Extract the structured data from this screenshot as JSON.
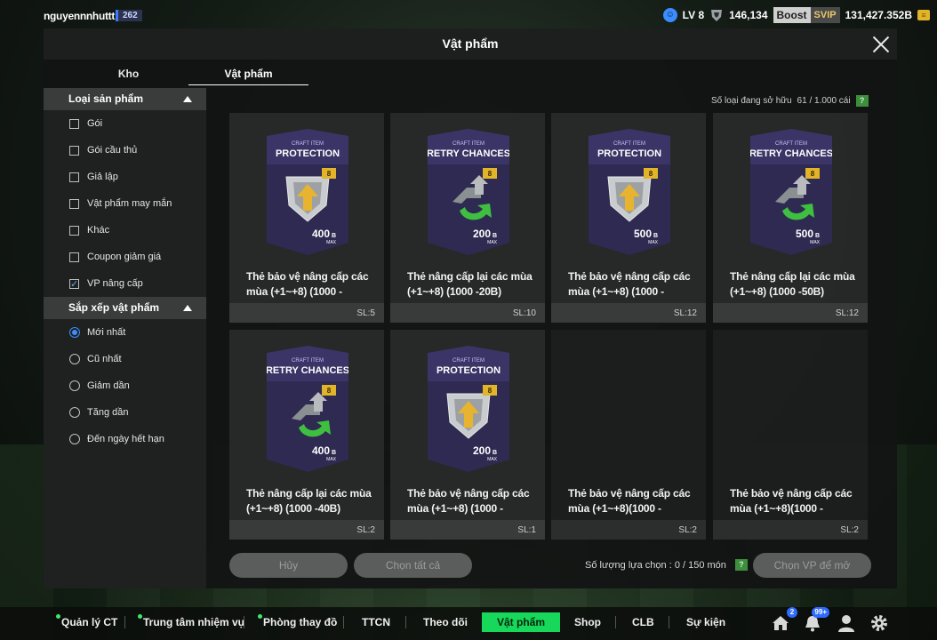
{
  "top": {
    "username": "nguyennnhuttt",
    "user_level": "262",
    "lv": "LV 8",
    "points": "146,134",
    "boost": "Boost",
    "svip": "SVIP",
    "balance": "131,427.352B"
  },
  "modal": {
    "title": "Vật phẩm",
    "tabs": [
      "Kho",
      "Vật phẩm"
    ]
  },
  "sidebar": {
    "product_type_title": "Loại sản phẩm",
    "product_types": [
      {
        "label": "Gói",
        "checked": false
      },
      {
        "label": "Gói cầu thủ",
        "checked": false
      },
      {
        "label": "Giả lập",
        "checked": false
      },
      {
        "label": "Vật phẩm may mắn",
        "checked": false
      },
      {
        "label": "Khác",
        "checked": false
      },
      {
        "label": "Coupon giảm giá",
        "checked": false
      },
      {
        "label": "VP nâng cấp",
        "checked": true
      }
    ],
    "sort_title": "Sắp xếp vật phẩm",
    "sort_options": [
      {
        "label": "Mới nhất",
        "selected": true
      },
      {
        "label": "Cũ nhất",
        "selected": false
      },
      {
        "label": "Giảm dần",
        "selected": false
      },
      {
        "label": "Tăng dần",
        "selected": false
      },
      {
        "label": "Đến ngày hết hạn",
        "selected": false
      }
    ]
  },
  "owned": {
    "label": "Số loại đang sở hữu",
    "value": "61 / 1.000 cái",
    "help": "?"
  },
  "items": [
    {
      "type": "PROTECTION",
      "craft": "CRAFT ITEM",
      "badge": "8",
      "price": "400",
      "unit": "B",
      "max": "MAX",
      "name_line1": "Thẻ bảo vệ nâng cấp các",
      "name_line2": "mùa (+1~+8) (1000 -",
      "qty": "SL:5"
    },
    {
      "type": "RETRY CHANCES",
      "craft": "CRAFT ITEM",
      "badge": "8",
      "price": "200",
      "unit": "B",
      "max": "MAX",
      "name_line1": "Thẻ nâng cấp lại các mùa",
      "name_line2": "(+1~+8) (1000 -20B)",
      "qty": "SL:10"
    },
    {
      "type": "PROTECTION",
      "craft": "CRAFT ITEM",
      "badge": "8",
      "price": "500",
      "unit": "B",
      "max": "MAX",
      "name_line1": "Thẻ bảo vệ nâng cấp các",
      "name_line2": "mùa (+1~+8) (1000 -",
      "qty": "SL:12"
    },
    {
      "type": "RETRY CHANCES",
      "craft": "CRAFT ITEM",
      "badge": "8",
      "price": "500",
      "unit": "B",
      "max": "MAX",
      "name_line1": "Thẻ nâng cấp lại các mùa",
      "name_line2": "(+1~+8) (1000 -50B)",
      "qty": "SL:12"
    },
    {
      "type": "RETRY CHANCES",
      "craft": "CRAFT ITEM",
      "badge": "8",
      "price": "400",
      "unit": "B",
      "max": "MAX",
      "name_line1": "Thẻ nâng cấp lại các mùa",
      "name_line2": "(+1~+8) (1000 -40B)",
      "qty": "SL:2"
    },
    {
      "type": "PROTECTION",
      "craft": "CRAFT ITEM",
      "badge": "8",
      "price": "200",
      "unit": "B",
      "max": "MAX",
      "name_line1": "Thẻ bảo vệ nâng cấp các",
      "name_line2": "mùa (+1~+8) (1000 -",
      "qty": "SL:1"
    },
    {
      "type": "",
      "craft": "",
      "badge": "",
      "price": "",
      "unit": "",
      "max": "",
      "name_line1": "Thẻ bảo vệ nâng cấp các",
      "name_line2": "mùa (+1~+8)(1000 -",
      "qty": "SL:2"
    },
    {
      "type": "",
      "craft": "",
      "badge": "",
      "price": "",
      "unit": "",
      "max": "",
      "name_line1": "Thẻ bảo vệ nâng cấp các",
      "name_line2": "mùa (+1~+8)(1000 -",
      "qty": "SL:2"
    }
  ],
  "actions": {
    "cancel": "Hủy",
    "select_all": "Chọn tất cả",
    "selection_label": "Số lượng lựa chọn : 0 / 150 món",
    "help": "?",
    "choose_upgrade": "Chọn VP để mở"
  },
  "nav": {
    "items": [
      "Quản lý CT",
      "Trung tâm nhiệm vụ",
      "Phòng thay đồ",
      "TTCN",
      "Theo dõi",
      "Vật phẩm",
      "Shop",
      "CLB",
      "Sự kiện"
    ],
    "home_badge": "2",
    "bell_badge": "99+"
  },
  "colors": {
    "accent_green": "#17d85a",
    "card_purple": "#2e2a52",
    "gold": "#e2b429"
  }
}
